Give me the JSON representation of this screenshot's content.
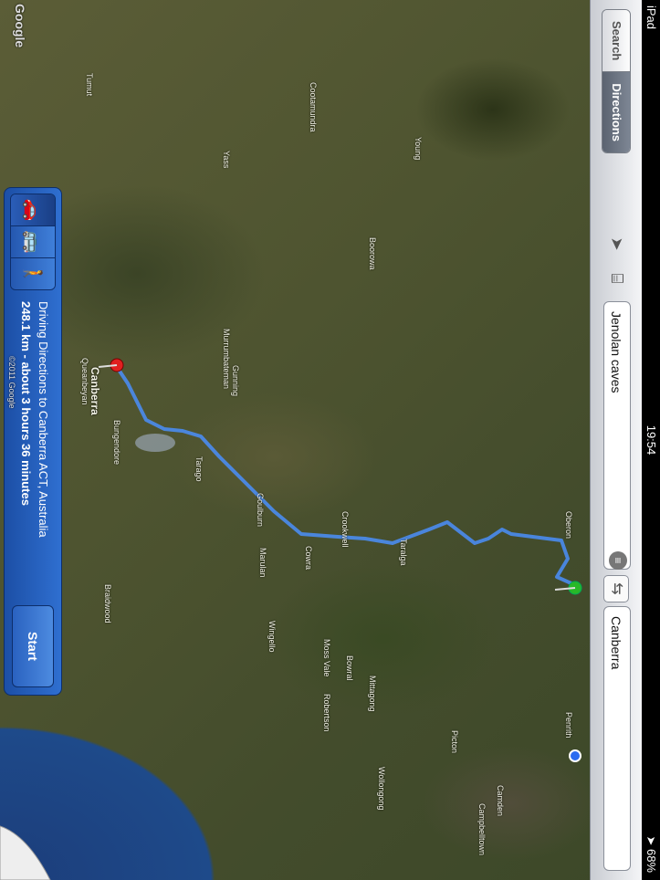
{
  "status_bar": {
    "device": "iPad",
    "time": "19:54",
    "battery": "68%"
  },
  "toolbar": {
    "tabs": [
      {
        "label": "Search",
        "active": false
      },
      {
        "label": "Directions",
        "active": true
      }
    ],
    "start_field": "Jenolan caves",
    "end_field": "Canberra"
  },
  "directions_panel": {
    "title": "Driving Directions to Canberra ACT, Australia",
    "summary": "248.1 km - about 3 hours 36 minutes",
    "start_label": "Start",
    "modes": [
      "car-icon",
      "bus-icon",
      "walk-icon"
    ]
  },
  "map": {
    "labels": [
      "Cowra",
      "Goulburn",
      "Queanbeyan",
      "Canberra",
      "Yass",
      "Gunning",
      "Crookwell",
      "Taralga",
      "Oberon",
      "Mittagong",
      "Moss Vale",
      "Bowral",
      "Wollongong",
      "Penrith",
      "Picton",
      "Boorowa",
      "Young",
      "Cootamundra",
      "Murrumbateman",
      "Bungendore",
      "Marulan",
      "Tarago",
      "Braidwood",
      "Tumut",
      "Wingello",
      "Robertson",
      "Camden",
      "Campbelltown"
    ],
    "copyright": "©2011 Google",
    "logo": "Google"
  }
}
